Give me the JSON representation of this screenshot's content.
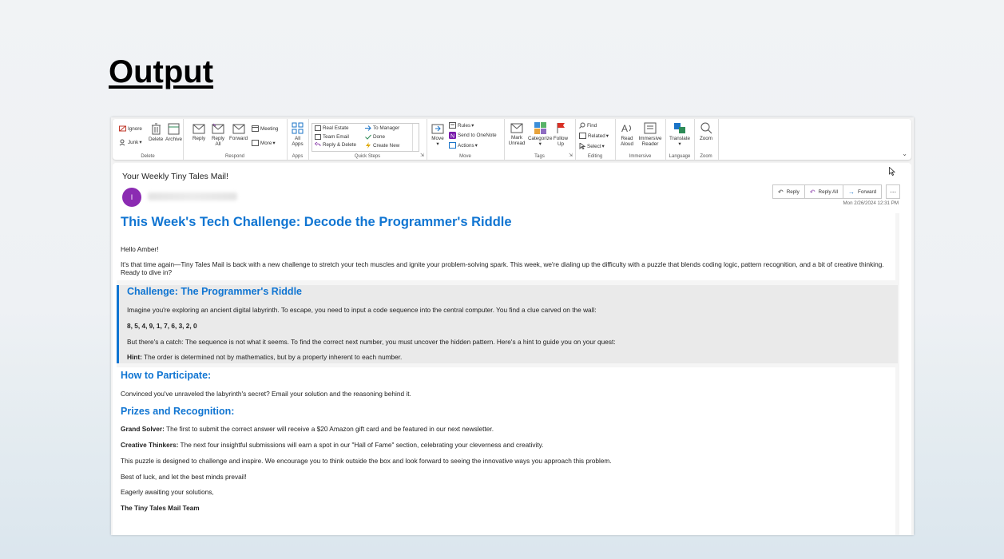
{
  "heading": "Output",
  "ribbon": {
    "delete_group": {
      "label": "Delete",
      "ignore": "Ignore",
      "junk": "Junk",
      "delete": "Delete",
      "archive": "Archive"
    },
    "respond_group": {
      "label": "Respond",
      "reply": "Reply",
      "reply_all": "Reply All",
      "forward": "Forward",
      "meeting": "Meeting",
      "more": "More"
    },
    "apps_group": {
      "label": "Apps",
      "all_apps": "All Apps"
    },
    "quick_steps": {
      "label": "Quick Steps",
      "items": [
        "Real Estate",
        "To Manager",
        "Team Email",
        "Done",
        "Reply & Delete",
        "Create New"
      ]
    },
    "move_group": {
      "label": "Move",
      "move": "Move",
      "rules": "Rules",
      "onenote": "Send to OneNote",
      "actions": "Actions"
    },
    "tags_group": {
      "label": "Tags",
      "mark_unread": "Mark Unread",
      "categorize": "Categorize",
      "follow_up": "Follow Up"
    },
    "editing_group": {
      "label": "Editing",
      "find": "Find",
      "related": "Related",
      "select": "Select"
    },
    "immersive_group": {
      "label": "Immersive",
      "read_aloud": "Read Aloud",
      "immersive_reader": "Immersive Reader"
    },
    "language_group": {
      "label": "Language",
      "translate": "Translate"
    },
    "zoom_group": {
      "label": "Zoom",
      "zoom": "Zoom"
    }
  },
  "message": {
    "subject": "Your Weekly Tiny Tales Mail!",
    "avatar_initial": "I",
    "reply": "Reply",
    "reply_all": "Reply All",
    "forward": "Forward",
    "datetime": "Mon 2/26/2024 12:31 PM"
  },
  "email": {
    "title": "This Week's Tech Challenge: Decode the Programmer's Riddle",
    "greeting": "Hello Amber!",
    "intro": "It's that time again—Tiny Tales Mail is back with a new challenge to stretch your tech muscles and ignite your problem-solving spark. This week, we're dialing up the difficulty with a puzzle that blends coding logic, pattern recognition, and a bit of creative thinking. Ready to dive in?",
    "challenge_heading": "Challenge: The Programmer's Riddle",
    "challenge_text": "Imagine you're exploring an ancient digital labyrinth. To escape, you need to input a code sequence into the central computer. You find a clue carved on the wall:",
    "sequence": "8, 5, 4, 9, 1, 7, 6, 3, 2, 0",
    "catch_text": "But there's a catch: The sequence is not what it seems. To find the correct next number, you must uncover the hidden pattern. Here's a hint to guide you on your quest:",
    "hint_label": "Hint:",
    "hint_text": " The order is determined not by mathematics, but by a property inherent to each number.",
    "participate_heading": "How to Participate:",
    "participate_text": "Convinced you've unraveled the labyrinth's secret? Email your solution and the reasoning behind it.",
    "prizes_heading": "Prizes and Recognition:",
    "grand_label": "Grand Solver:",
    "grand_text": " The first to submit the correct answer will receive a $20 Amazon gift card and be featured in our next newsletter.",
    "creative_label": "Creative Thinkers:",
    "creative_text": " The next four insightful submissions will earn a spot in our \"Hall of Fame\" section, celebrating your cleverness and creativity.",
    "closing_1": "This puzzle is designed to challenge and inspire. We encourage you to think outside the box and look forward to seeing the innovative ways you approach this problem.",
    "closing_2": "Best of luck, and let the best minds prevail!",
    "closing_3": "Eagerly awaiting your solutions,",
    "signature": "The Tiny Tales Mail Team"
  }
}
